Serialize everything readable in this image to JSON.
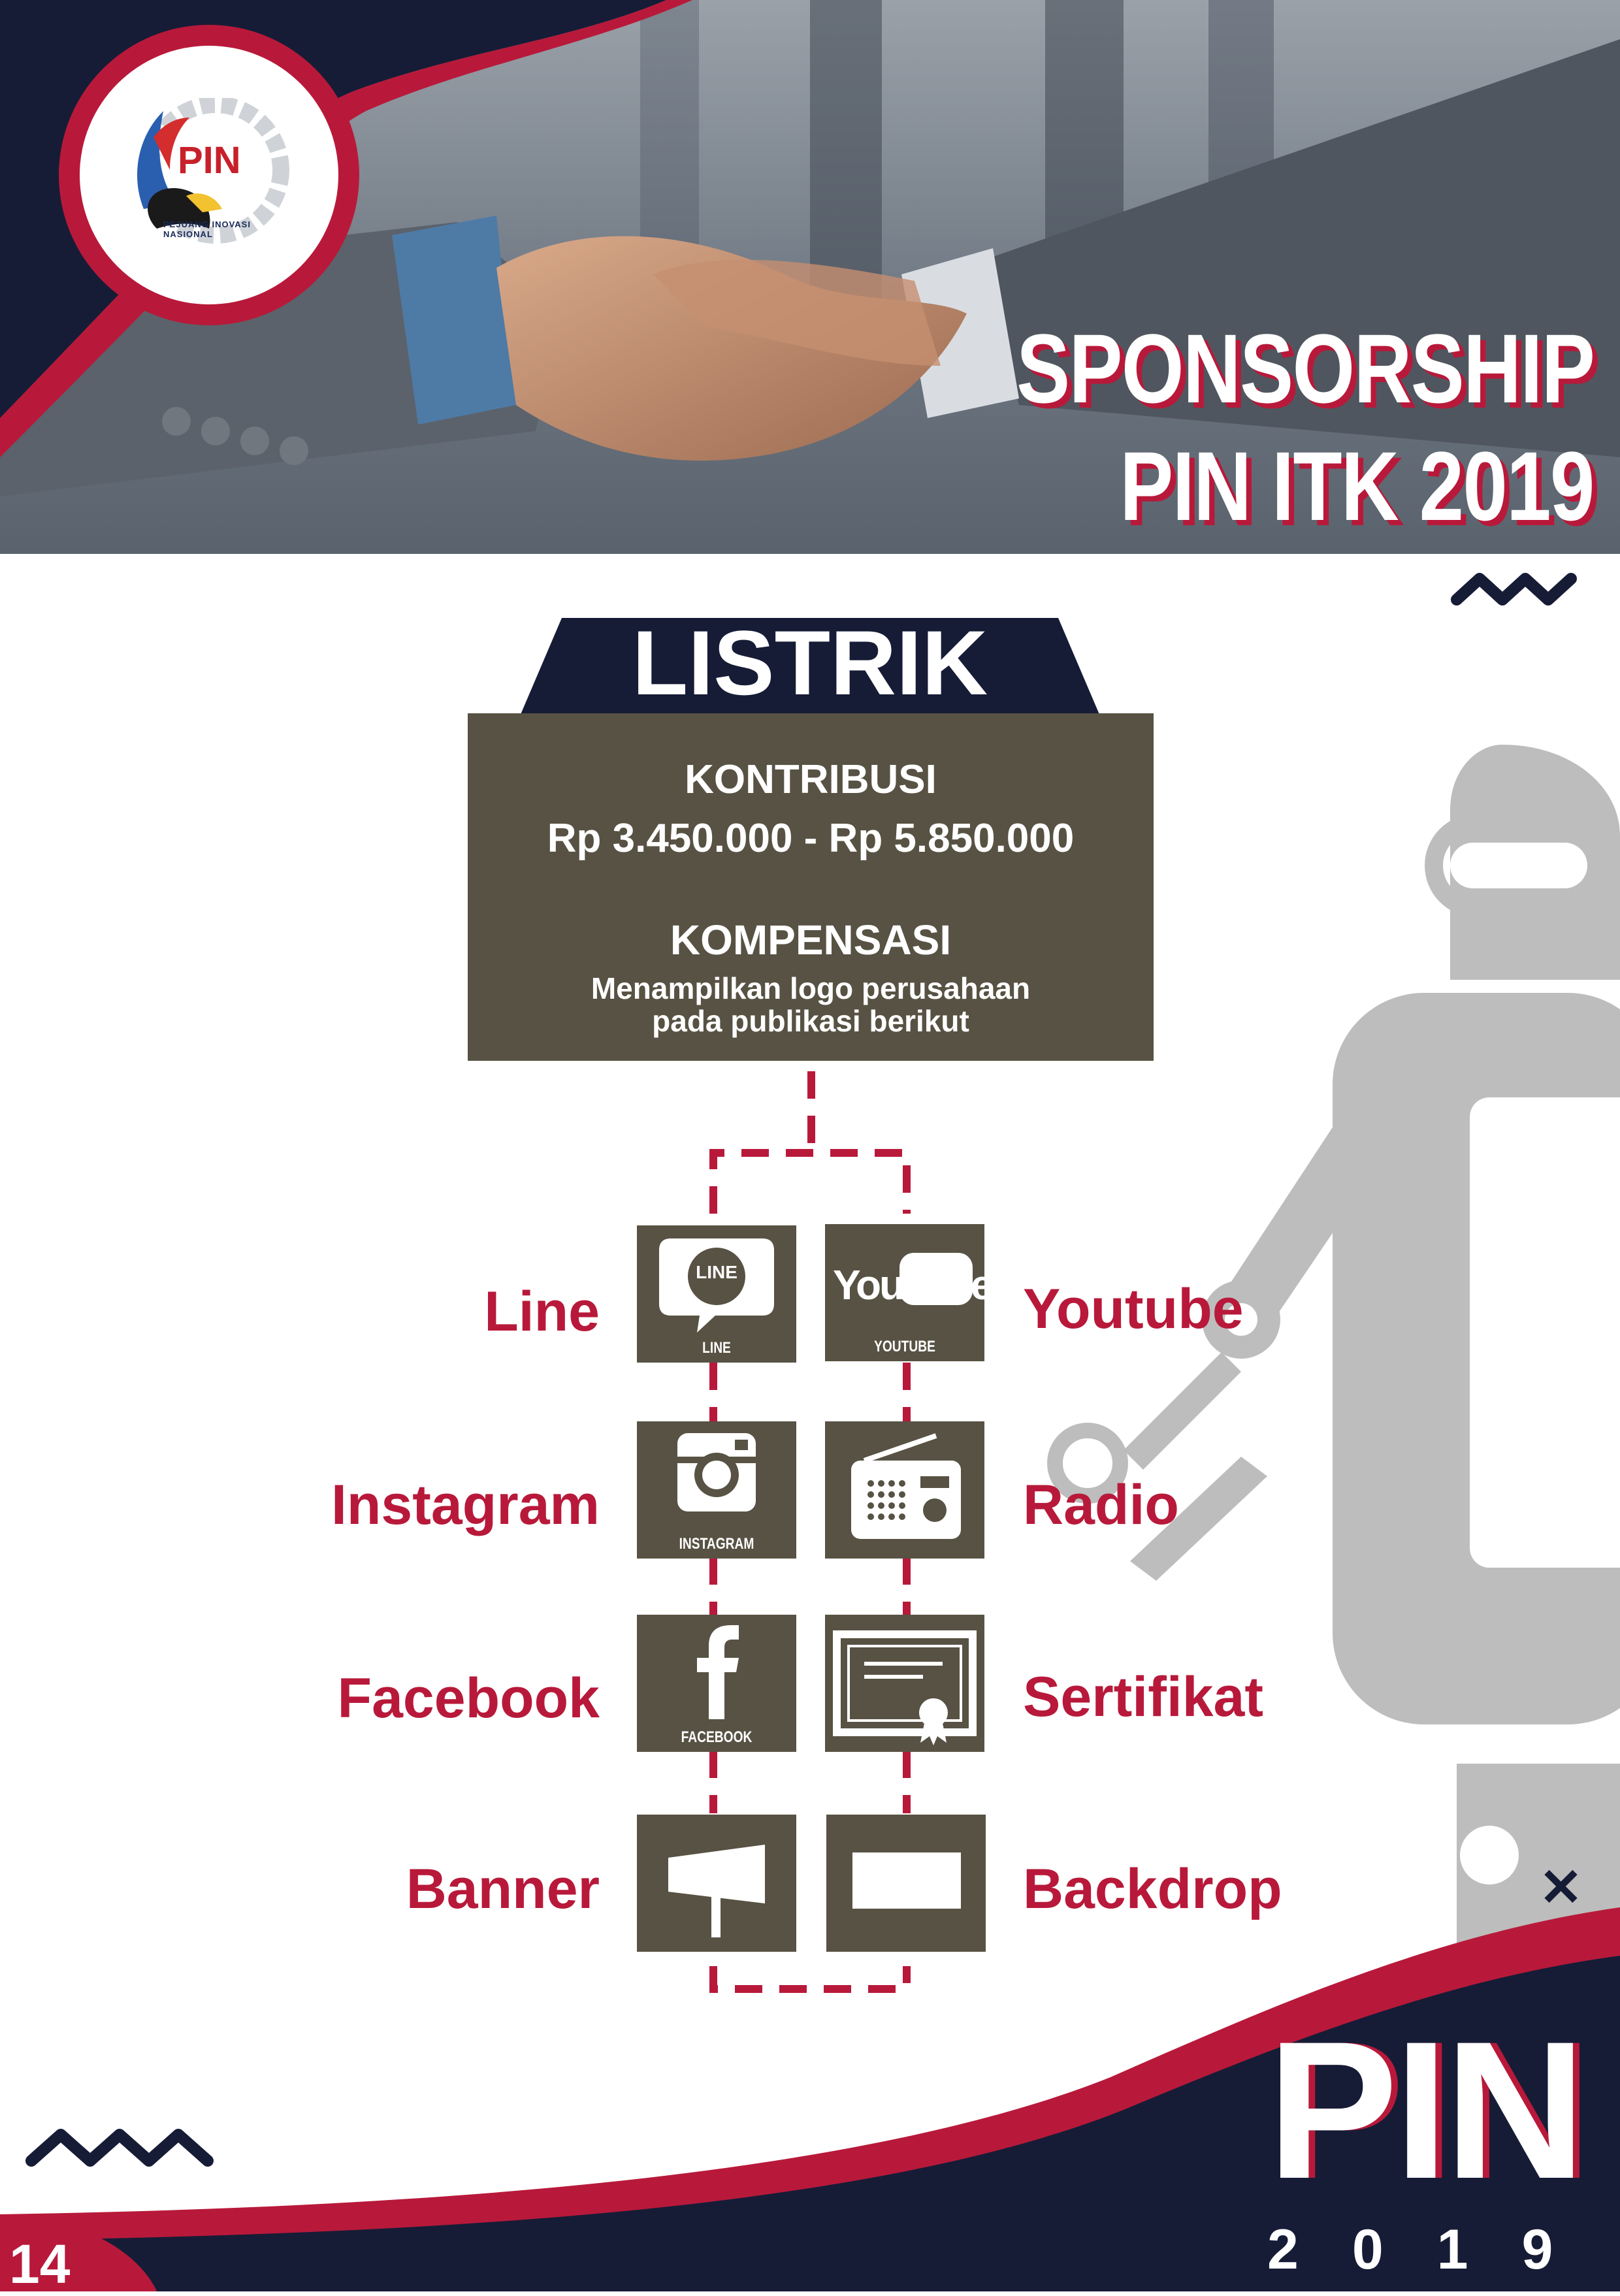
{
  "header": {
    "title_line1": "SPONSORSHIP",
    "title_line2": "PIN ITK 2019",
    "logo_text": "PIN",
    "logo_ring_text": "PEJUANG INOVASI NASIONAL"
  },
  "tier": {
    "name": "LISTRIK",
    "contribution_heading": "KONTRIBUSI",
    "contribution_range": "Rp 3.450.000 - Rp 5.850.000",
    "compensation_heading": "KOMPENSASI",
    "compensation_line1": "Menampilkan logo perusahaan",
    "compensation_line2": "pada publikasi berikut"
  },
  "media": {
    "left": [
      {
        "label": "Line",
        "icon": "line-icon",
        "tile_text": "LINE",
        "icon_text": "LINE"
      },
      {
        "label": "Instagram",
        "icon": "instagram-icon",
        "tile_text": "INSTAGRAM"
      },
      {
        "label": "Facebook",
        "icon": "facebook-icon",
        "tile_text": "FACEBOOK"
      },
      {
        "label": "Banner",
        "icon": "banner-icon"
      }
    ],
    "right": [
      {
        "label": "Youtube",
        "icon": "youtube-icon",
        "tile_text": "YOUTUBE",
        "icon_text": "YouTube"
      },
      {
        "label": "Radio",
        "icon": "radio-icon"
      },
      {
        "label": "Sertifikat",
        "icon": "certificate-icon"
      },
      {
        "label": "Backdrop",
        "icon": "backdrop-icon"
      }
    ]
  },
  "footer": {
    "page_number": "14",
    "pin_text": "PIN",
    "year": "2019"
  },
  "colors": {
    "navy": "#161c36",
    "crimson": "#b8193a",
    "tile_brown": "#575243",
    "box_olive": "#575243",
    "robot_grey": "#bdbdbd"
  }
}
